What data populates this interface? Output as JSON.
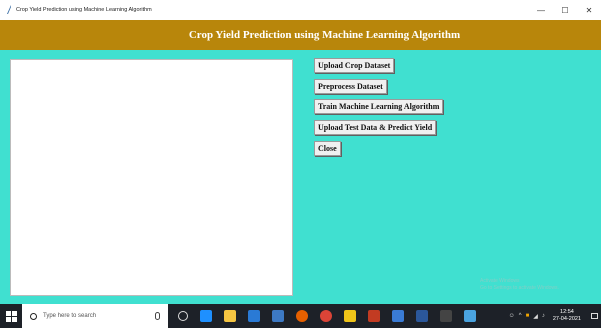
{
  "window": {
    "title": "Crop Yield Prediction using Machine Learning Algorithm",
    "minimize": "—",
    "maximize": "☐",
    "close": "✕"
  },
  "header": {
    "title": "Crop Yield Prediction using Machine Learning Algorithm"
  },
  "buttons": {
    "upload_dataset": "Upload Crop Dataset",
    "preprocess": "Preprocess Dataset",
    "train": "Train Machine Learning Algorithm",
    "upload_test": "Upload Test Data & Predict Yield",
    "close": "Close"
  },
  "output": {
    "text": ""
  },
  "watermark": {
    "line1": "Activate Windows",
    "line2": "Go to Settings to activate Windows."
  },
  "taskbar": {
    "search_placeholder": "Type here to search",
    "time": "12:54",
    "date": "27-04-2021",
    "icons": [
      "cortana-icon",
      "task-view-icon",
      "file-explorer-icon",
      "store-icon",
      "edge-icon",
      "python-icon",
      "firefox-icon",
      "chrome-icon",
      "notepad-icon",
      "mail-icon",
      "paint-icon",
      "word-icon",
      "terminal-icon",
      "app-icon"
    ]
  },
  "colors": {
    "background": "#40e0d0",
    "header": "#b8860b",
    "taskbar": "#1d2128"
  }
}
